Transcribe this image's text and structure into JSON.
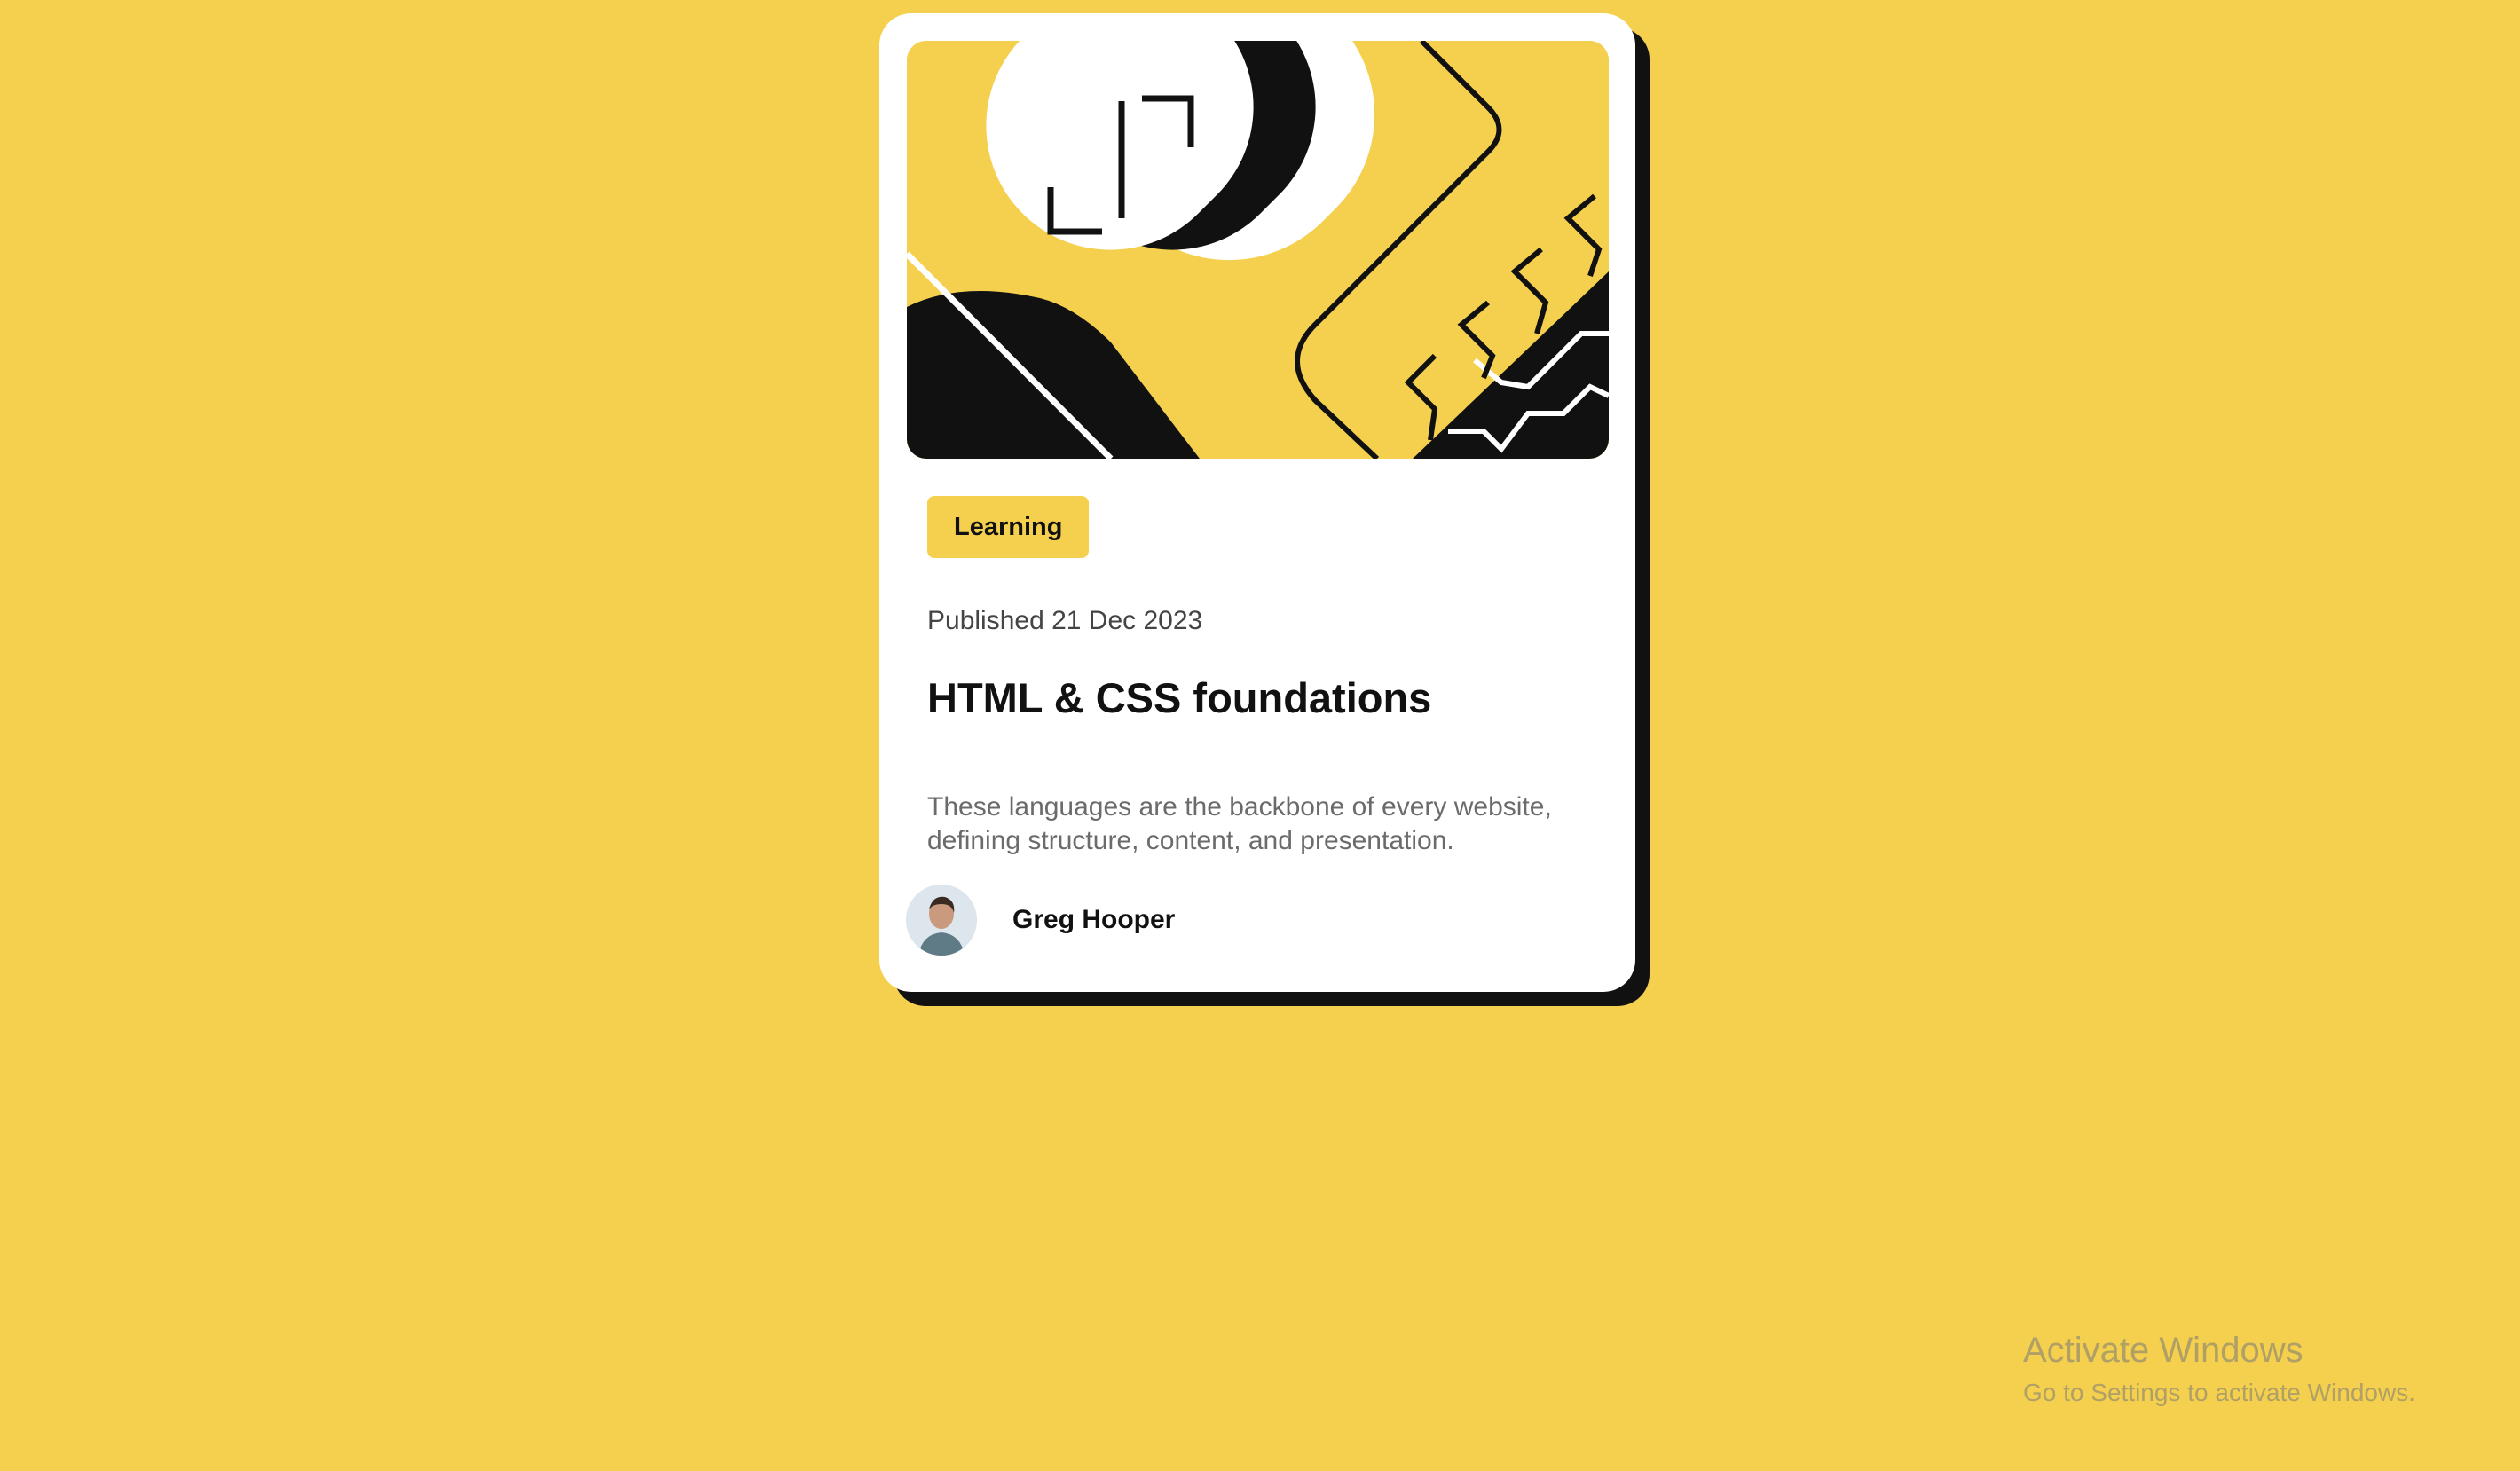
{
  "colors": {
    "background": "#F4D04E",
    "card": "#FFFFFF",
    "shadow": "#111111",
    "accent": "#F4D04E",
    "text": "#111111",
    "muted": "#6B6B6B"
  },
  "card": {
    "hero_icon": "abstract-illustration-icon",
    "badge": "Learning",
    "published": "Published 21 Dec 2023",
    "title": "HTML & CSS foundations",
    "description": "These languages are the backbone of every website, defining structure, content, and presentation.",
    "author": {
      "name": "Greg Hooper",
      "avatar_icon": "avatar-icon"
    }
  },
  "watermark": {
    "title": "Activate Windows",
    "subtitle": "Go to Settings to activate Windows."
  }
}
